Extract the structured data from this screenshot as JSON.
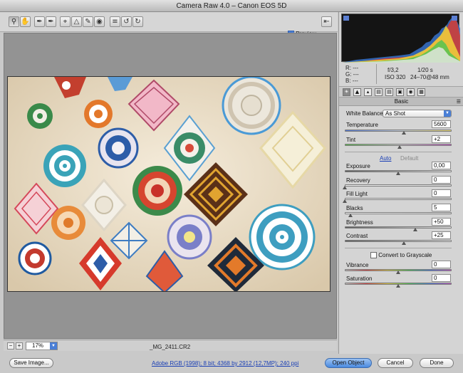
{
  "window": {
    "title": "Camera Raw 4.0  –  Canon EOS 5D"
  },
  "toolbar": {
    "tools": [
      {
        "name": "zoom-tool",
        "glyph": "🔍"
      },
      {
        "name": "hand-tool",
        "glyph": "✋"
      },
      {
        "name": "white-balance-tool",
        "glyph": "✒"
      },
      {
        "name": "color-sampler-tool",
        "glyph": "✒"
      },
      {
        "name": "crop-tool",
        "glyph": "⌗"
      },
      {
        "name": "straighten-tool",
        "glyph": "△"
      },
      {
        "name": "retouch-tool",
        "glyph": "✎"
      },
      {
        "name": "red-eye-tool",
        "glyph": "◉"
      },
      {
        "name": "preferences-tool",
        "glyph": "≡"
      },
      {
        "name": "rotate-left-tool",
        "glyph": "↺"
      },
      {
        "name": "rotate-right-tool",
        "glyph": "↻"
      }
    ],
    "preview_label": "Preview",
    "preview_checked": true
  },
  "canvas": {
    "zoom": "17%",
    "filename": "_MG_2411.CR2"
  },
  "camera_info": {
    "r": "R:   ---",
    "g": "G:   ---",
    "b": "B:   ---",
    "aperture": "f/3,2",
    "shutter": "1/20 s",
    "iso": "ISO 320",
    "lens": "24–70@48 mm"
  },
  "panel": {
    "section_title": "Basic",
    "white_balance_label": "White Balance:",
    "white_balance_value": "As Shot",
    "auto_label": "Auto",
    "default_label": "Default",
    "grayscale_label": "Convert to Grayscale"
  },
  "controls": [
    {
      "label": "Temperature",
      "value": "5600",
      "level": 0.55
    },
    {
      "label": "Tint",
      "value": "+2",
      "level": 0.51
    },
    {
      "label": "Exposure",
      "value": "0,00",
      "level": 0.5
    },
    {
      "label": "Recovery",
      "value": "0",
      "level": 0.0
    },
    {
      "label": "Fill Light",
      "value": "0",
      "level": 0.0
    },
    {
      "label": "Blacks",
      "value": "5",
      "level": 0.05
    },
    {
      "label": "Brightness",
      "value": "+50",
      "level": 0.66
    },
    {
      "label": "Contrast",
      "value": "+25",
      "level": 0.55
    },
    {
      "label": "Vibrance",
      "value": "0",
      "level": 0.5
    },
    {
      "label": "Saturation",
      "value": "0",
      "level": 0.5
    }
  ],
  "footer": {
    "save_label": "Save Image...",
    "info_link": "Adobe RGB (1998); 8 bit; 4368 by 2912 (12,7MP); 240 ppi",
    "open_label": "Open Object",
    "cancel_label": "Cancel",
    "done_label": "Done"
  },
  "colors": {
    "accent": "#4a7fd6",
    "link": "#1a3fb5"
  }
}
